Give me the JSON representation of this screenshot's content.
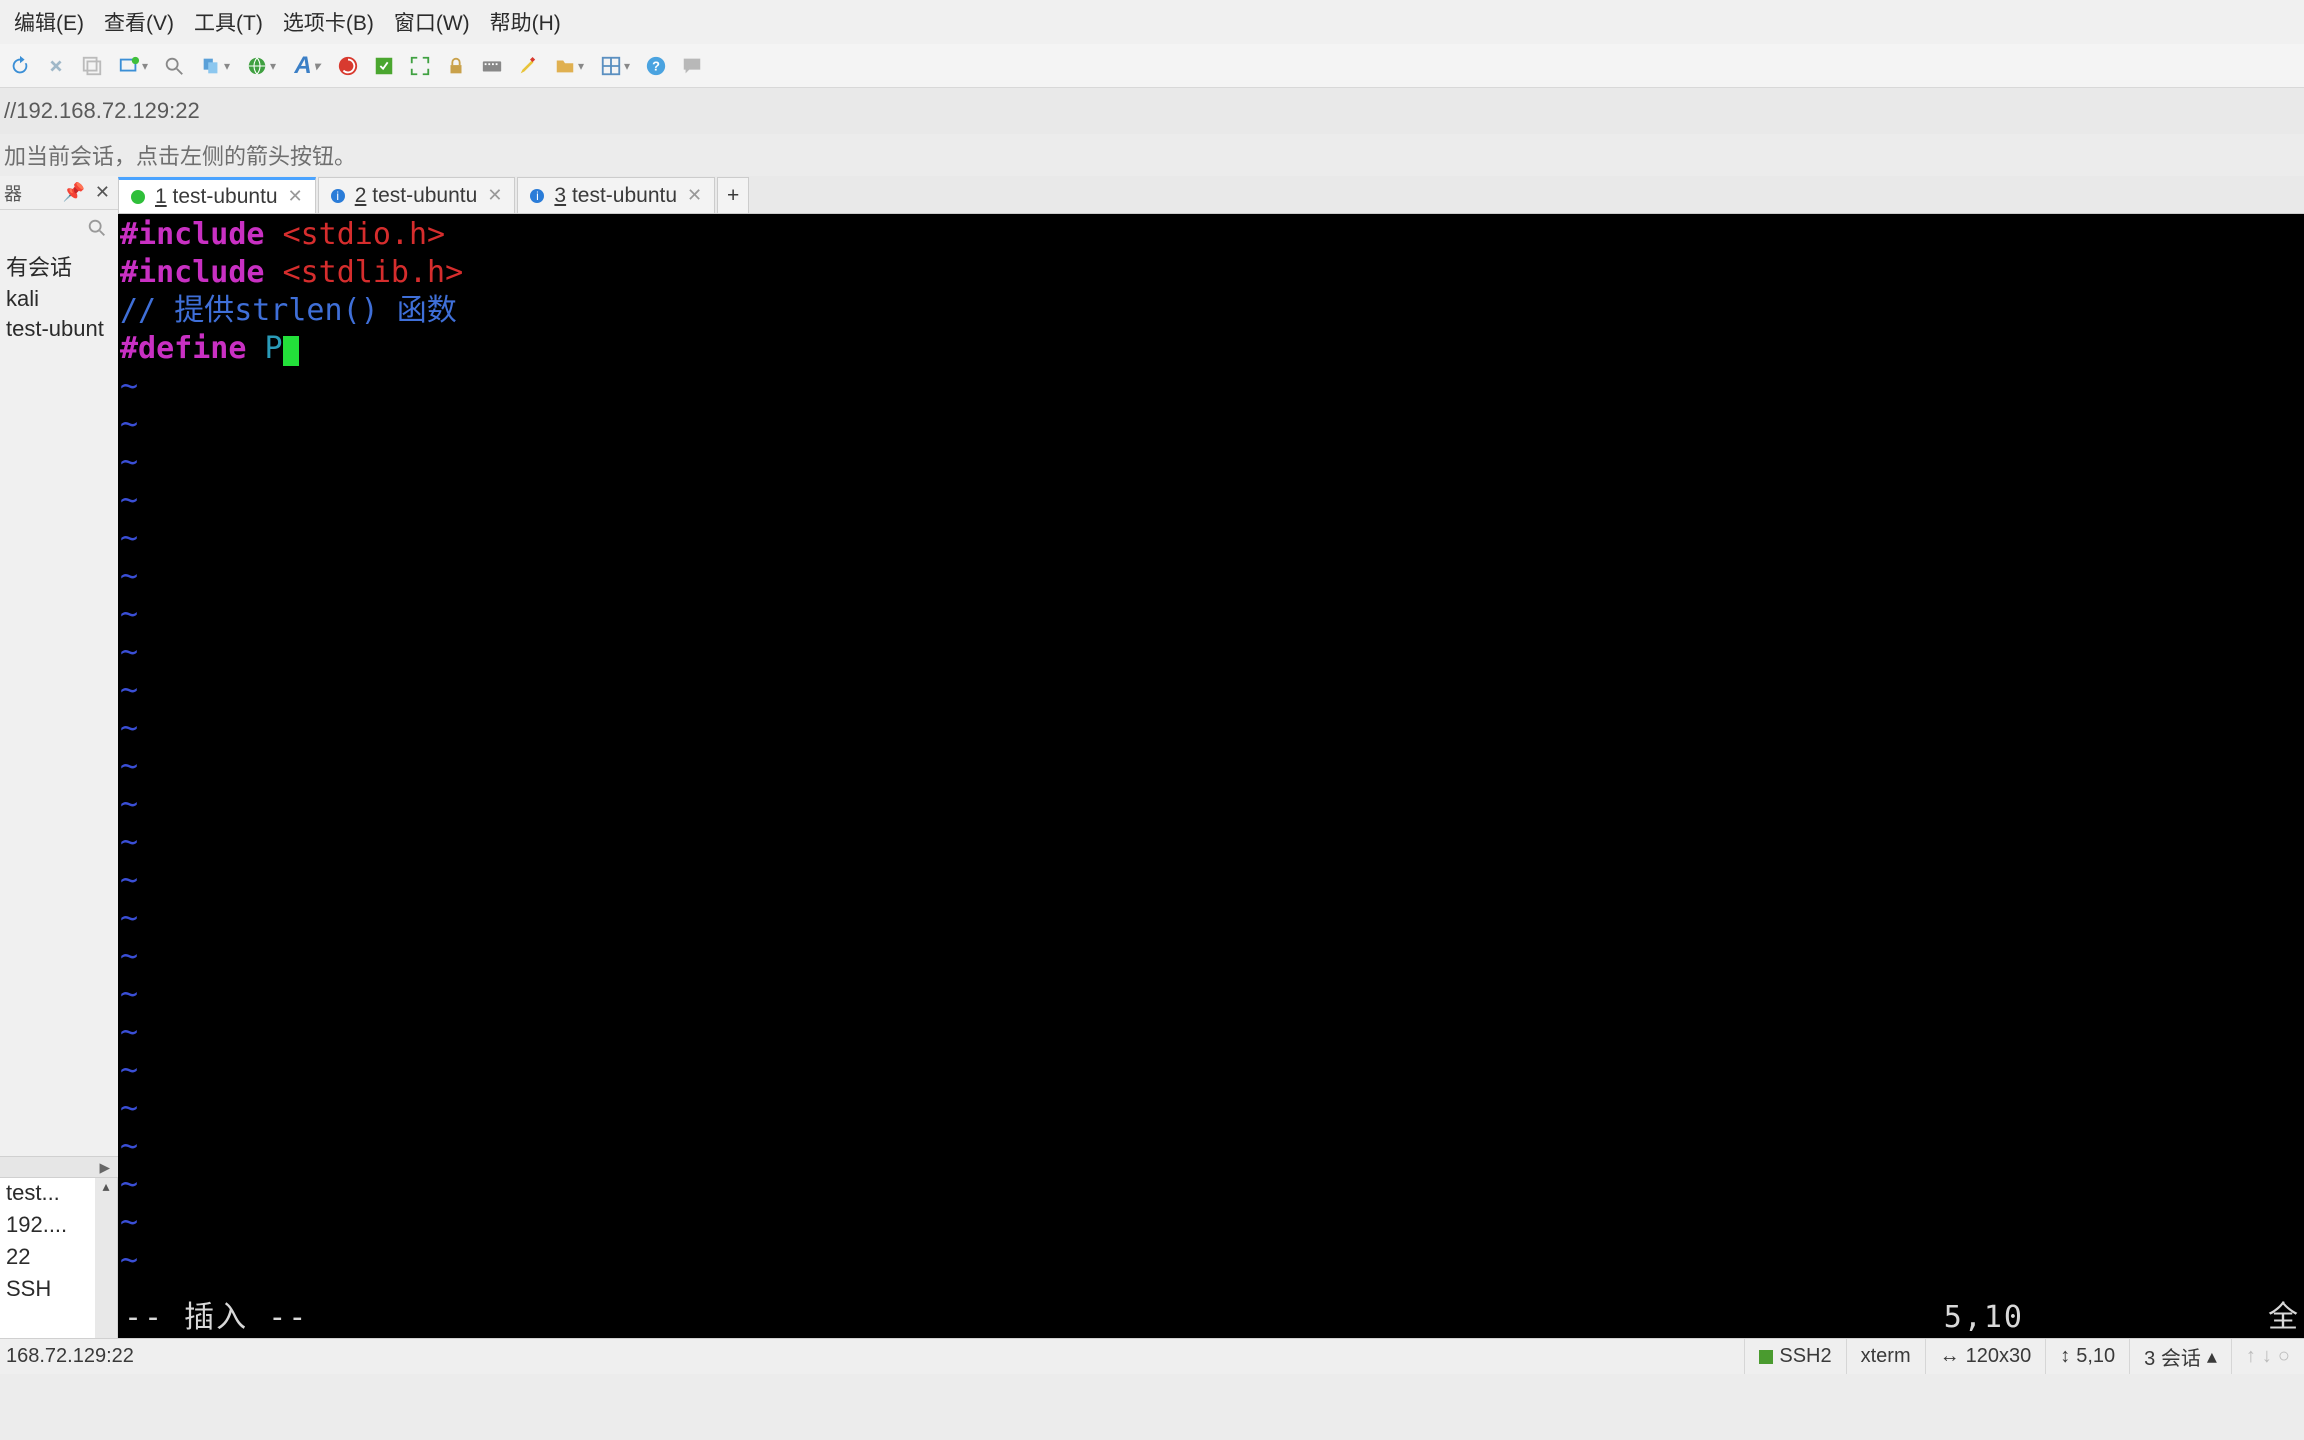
{
  "menubar": {
    "edit": "编辑(E)",
    "view": "查看(V)",
    "tools": "工具(T)",
    "tabs": "选项卡(B)",
    "window": "窗口(W)",
    "help": "帮助(H)"
  },
  "address": "//192.168.72.129:22",
  "hint": "加当前会话，点击左侧的箭头按钮。",
  "sidebar": {
    "header_label": "器",
    "items": [
      "有会话",
      "kali",
      "test-ubunt"
    ],
    "info": [
      "test...",
      "192....",
      "22",
      "SSH",
      ""
    ]
  },
  "tabs": [
    {
      "num": "1",
      "label": "test-ubuntu",
      "active": true,
      "kind": "ok"
    },
    {
      "num": "2",
      "label": "test-ubuntu",
      "active": false,
      "kind": "info"
    },
    {
      "num": "3",
      "label": "test-ubuntu",
      "active": false,
      "kind": "info"
    }
  ],
  "terminal": {
    "l1a": "#include ",
    "l1b": "<stdio.h>",
    "l2a": "#include ",
    "l2b": "<stdlib.h>",
    "l3": "",
    "l4a": "// ",
    "l4b": "提供",
    "l4c": "strlen() ",
    "l4d": "函数",
    "l5a": "#define ",
    "l5b": "P",
    "tilde": "~",
    "mode": "-- 插入 --",
    "pos": "5,10",
    "all": "全"
  },
  "statusbar": {
    "left": "168.72.129:22",
    "ssh": "SSH2",
    "size": "120x30",
    "cursor": "5,10",
    "sessions": "3 会话",
    "size_prefix": "↕",
    "cursor_prefix": "↕"
  },
  "terminal_type": "xterm"
}
